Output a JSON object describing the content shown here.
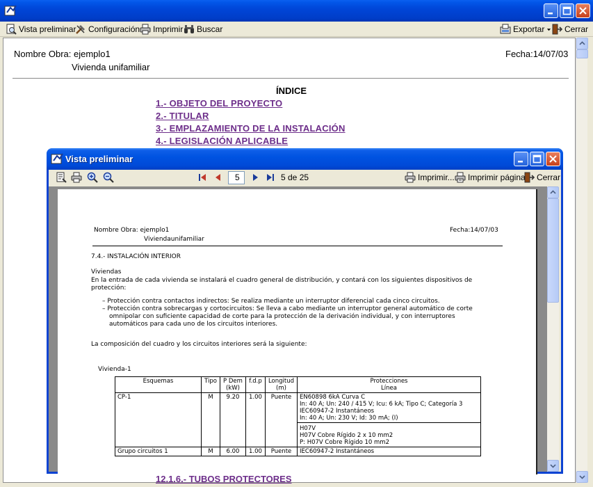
{
  "main": {
    "toolbar": {
      "vista_preliminar": "Vista preliminar",
      "configuracion": "Configuración",
      "imprimir": "Imprimir",
      "buscar": "Buscar",
      "exportar": "Exportar",
      "cerrar": "Cerrar"
    },
    "doc": {
      "nombre_obra": "Nombre Obra: ejemplo1",
      "vivienda": "Vivienda unifamiliar",
      "fecha": "Fecha:14/07/03",
      "indice_title": "ÍNDICE",
      "toc": [
        "1.- OBJETO DEL PROYECTO",
        "2.- TITULAR",
        "3.- EMPLAZAMIENTO DE LA INSTALACIÓN",
        "4.- LEGISLACIÓN APLICABLE"
      ],
      "toc_bottom": "12.1.6.- TUBOS PROTECTORES"
    }
  },
  "preview": {
    "title": "Vista preliminar",
    "page_input": "5",
    "page_count": "5 de 25",
    "imprimir": "Imprimir...",
    "imprimir_pagina": "Imprimir página",
    "cerrar": "Cerrar",
    "page": {
      "nombre_obra": "Nombre Obra:  ejemplo1",
      "vivienda": "Viviendaunifamiliar",
      "fecha": "Fecha:14/07/03",
      "section": "7.4.-  INSTALACIÓN  INTERIOR",
      "viviendas": "Viviendas",
      "intro_1": "En la entrada de cada vivienda se instalará el cuadro general de distribución, y contará con los siguientes dispositivos de",
      "intro_2": "protección:",
      "bullet_1": "– Protección contra contactos indirectos: Se realiza mediante un interruptor diferencial cada cinco circuitos.",
      "bullet_2a": "– Protección contra sobrecargas y cortocircuitos: Se lleva a cabo mediante un interruptor general automático de corte",
      "bullet_2b": "omnipolar con suficiente capacidad de corte para la protección de la derivación individual, y con interruptores",
      "bullet_2c": "automáticos para cada uno de los circuitos interiores.",
      "composicion": "La composición del cuadro y los circuitos interiores será la siguiente:",
      "vivienda1": "Vivienda-1",
      "table": {
        "headers": [
          "Esquemas",
          "Tipo",
          "P Dem",
          "f.d.p",
          "Longitud",
          "Protecciones"
        ],
        "header_units": [
          "",
          "",
          "(kW)",
          "",
          "(m)",
          "Línea"
        ],
        "rows": [
          {
            "esquema": "CP-1",
            "tipo": "M",
            "pdem": "9.20",
            "fdp": "1.00",
            "longitud": "Puente",
            "prot_1": "EN60898 6kA Curva C",
            "prot_2": "In: 40 A; Un: 240 / 415 V; Icu: 6 kA; Tipo C; Categoría 3",
            "prot_3": "IEC60947-2 Instantáneos",
            "prot_4": "In: 40 A; Un: 230 V; Id: 30 mA; (I)",
            "linea_1": "H07V",
            "linea_2": "H07V Cobre Rígido 2 x 10 mm2",
            "linea_3": "P: H07V Cobre Rígido 10 mm2"
          },
          {
            "esquema": "Grupo circuitos 1",
            "tipo": "M",
            "pdem": "6.00",
            "fdp": "1.00",
            "longitud": "Puente",
            "prot_1": "IEC60947-2 Instantáneos"
          }
        ]
      }
    }
  }
}
